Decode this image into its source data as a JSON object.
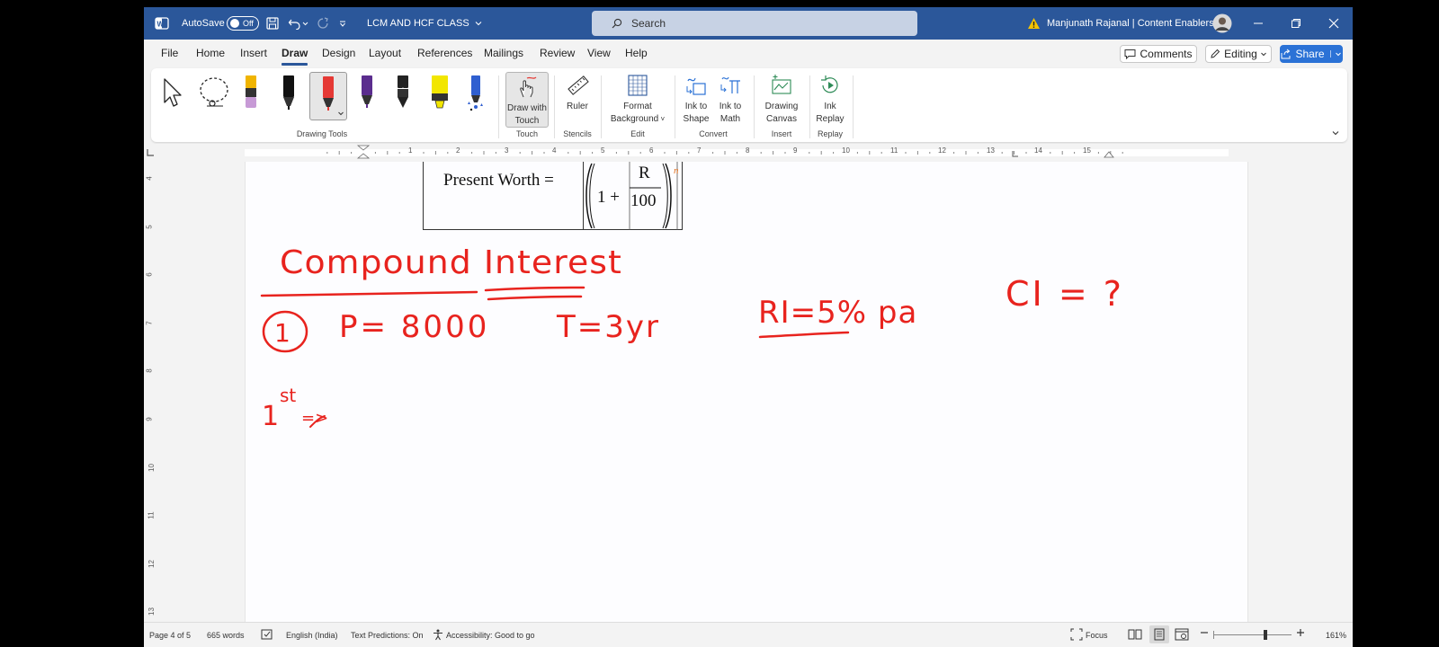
{
  "titlebar": {
    "autosave_label": "AutoSave",
    "autosave_state": "Off",
    "doc_title": "LCM AND HCF CLASS",
    "search_placeholder": "Search",
    "user": "Manjunath Rajanal | Content Enablers"
  },
  "menu": {
    "tabs": [
      "File",
      "Home",
      "Insert",
      "Draw",
      "Design",
      "Layout",
      "References",
      "Mailings",
      "Review",
      "View",
      "Help"
    ],
    "active": "Draw",
    "comments": "Comments",
    "editing": "Editing",
    "share": "Share"
  },
  "ribbon": {
    "groups": {
      "drawing_tools": "Drawing Tools",
      "touch": "Touch",
      "stencils": "Stencils",
      "edit": "Edit",
      "convert": "Convert",
      "insert": "Insert",
      "replay": "Replay"
    },
    "buttons": {
      "draw_with_touch_1": "Draw with",
      "draw_with_touch_2": "Touch",
      "ruler": "Ruler",
      "format_bg_1": "Format",
      "format_bg_2": "Background",
      "ink_shape_1": "Ink to",
      "ink_shape_2": "Shape",
      "ink_math_1": "Ink to",
      "ink_math_2": "Math",
      "drawing_canvas_1": "Drawing",
      "drawing_canvas_2": "Canvas",
      "ink_replay_1": "Ink",
      "ink_replay_2": "Replay"
    },
    "pen_colors": [
      "#c79ad6",
      "#111111",
      "#e53935",
      "#5b2d8e",
      "#222222",
      "#f2e600",
      "#2f5fd0"
    ]
  },
  "ruler": {
    "h_numbers": [
      "1",
      "2",
      "3",
      "4",
      "5",
      "6",
      "7",
      "8",
      "9",
      "10",
      "11",
      "12",
      "13",
      "14",
      "15"
    ],
    "v_numbers": [
      "4",
      "5",
      "6",
      "7",
      "8",
      "9",
      "10",
      "11",
      "12",
      "13"
    ]
  },
  "document": {
    "formula": {
      "label": "Present Worth =",
      "one_plus": "1 +",
      "numerator": "R",
      "denominator": "100",
      "exponent": "n"
    },
    "ink": {
      "heading": "Compound Interest",
      "item_number": "1",
      "principal": "P= 8000",
      "time": "T=3yr",
      "rate": "RI=5% pa",
      "ci": "CI = ?",
      "first": "1",
      "first_sup": "st",
      "arrow": "=>"
    },
    "ink_color": "#e8231e"
  },
  "status": {
    "page": "Page 4 of 5",
    "words": "665 words",
    "language": "English (India)",
    "predictions": "Text Predictions: On",
    "accessibility": "Accessibility: Good to go",
    "focus": "Focus",
    "zoom": "161%"
  }
}
